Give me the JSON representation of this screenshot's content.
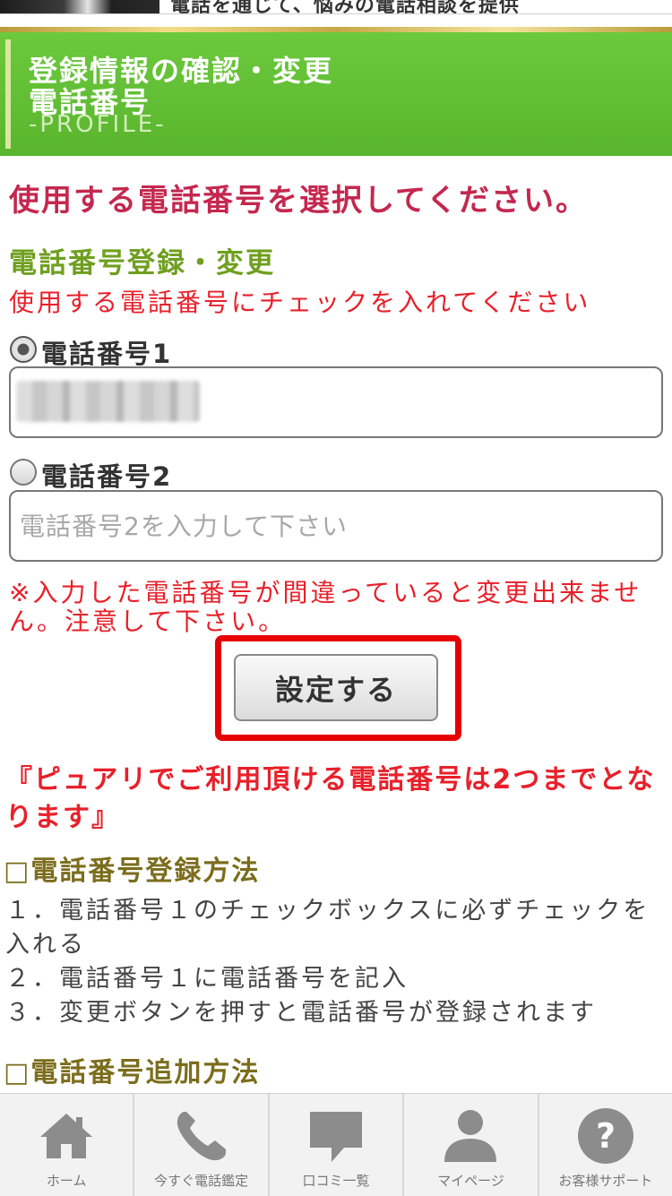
{
  "top_banner": {
    "text": "電話を通じて、悩みの電話相談を提供"
  },
  "header": {
    "title_line1": "登録情報の確認・変更",
    "title_line2": "電話番号",
    "subtitle": "-PROFILE-"
  },
  "main_heading": "使用する電話番号を選択してください。",
  "section_title": "電話番号登録・変更",
  "instruction": "使用する電話番号にチェックを入れてください",
  "phones": [
    {
      "label": "電話番号1",
      "checked": true,
      "value": "",
      "placeholder": ""
    },
    {
      "label": "電話番号2",
      "checked": false,
      "value": "",
      "placeholder": "電話番号2を入力して下さい"
    }
  ],
  "notice": "※入力した電話番号が間違っていると変更出来ません。注意して下さい。",
  "submit_label": "設定する",
  "policy_text": "『ピュアリでご利用頂ける電話番号は2つまでとなります』",
  "registration": {
    "title": "□電話番号登録方法",
    "steps": [
      "１．電話番号１のチェックボックスに必ずチェックを入れる",
      "２．電話番号１に電話番号を記入",
      "３．変更ボタンを押すと電話番号が登録されます"
    ]
  },
  "addition": {
    "title": "□電話番号追加方法"
  },
  "colors": {
    "header_green": "#5ab52e",
    "heading_crimson": "#c4284f",
    "alert_red": "#e8202a",
    "section_green": "#6f9f1f",
    "method_olive": "#7b6d1c",
    "highlight_red": "#e60000",
    "nav_icon_gray": "#8c8c8c"
  },
  "bottom_nav": [
    {
      "label": "ホーム",
      "icon": "home-icon"
    },
    {
      "label": "今すぐ電話鑑定",
      "icon": "phone-icon"
    },
    {
      "label": "口コミ一覧",
      "icon": "speech-bubble-icon"
    },
    {
      "label": "マイページ",
      "icon": "user-icon"
    },
    {
      "label": "お客様サポート",
      "icon": "help-icon"
    }
  ]
}
